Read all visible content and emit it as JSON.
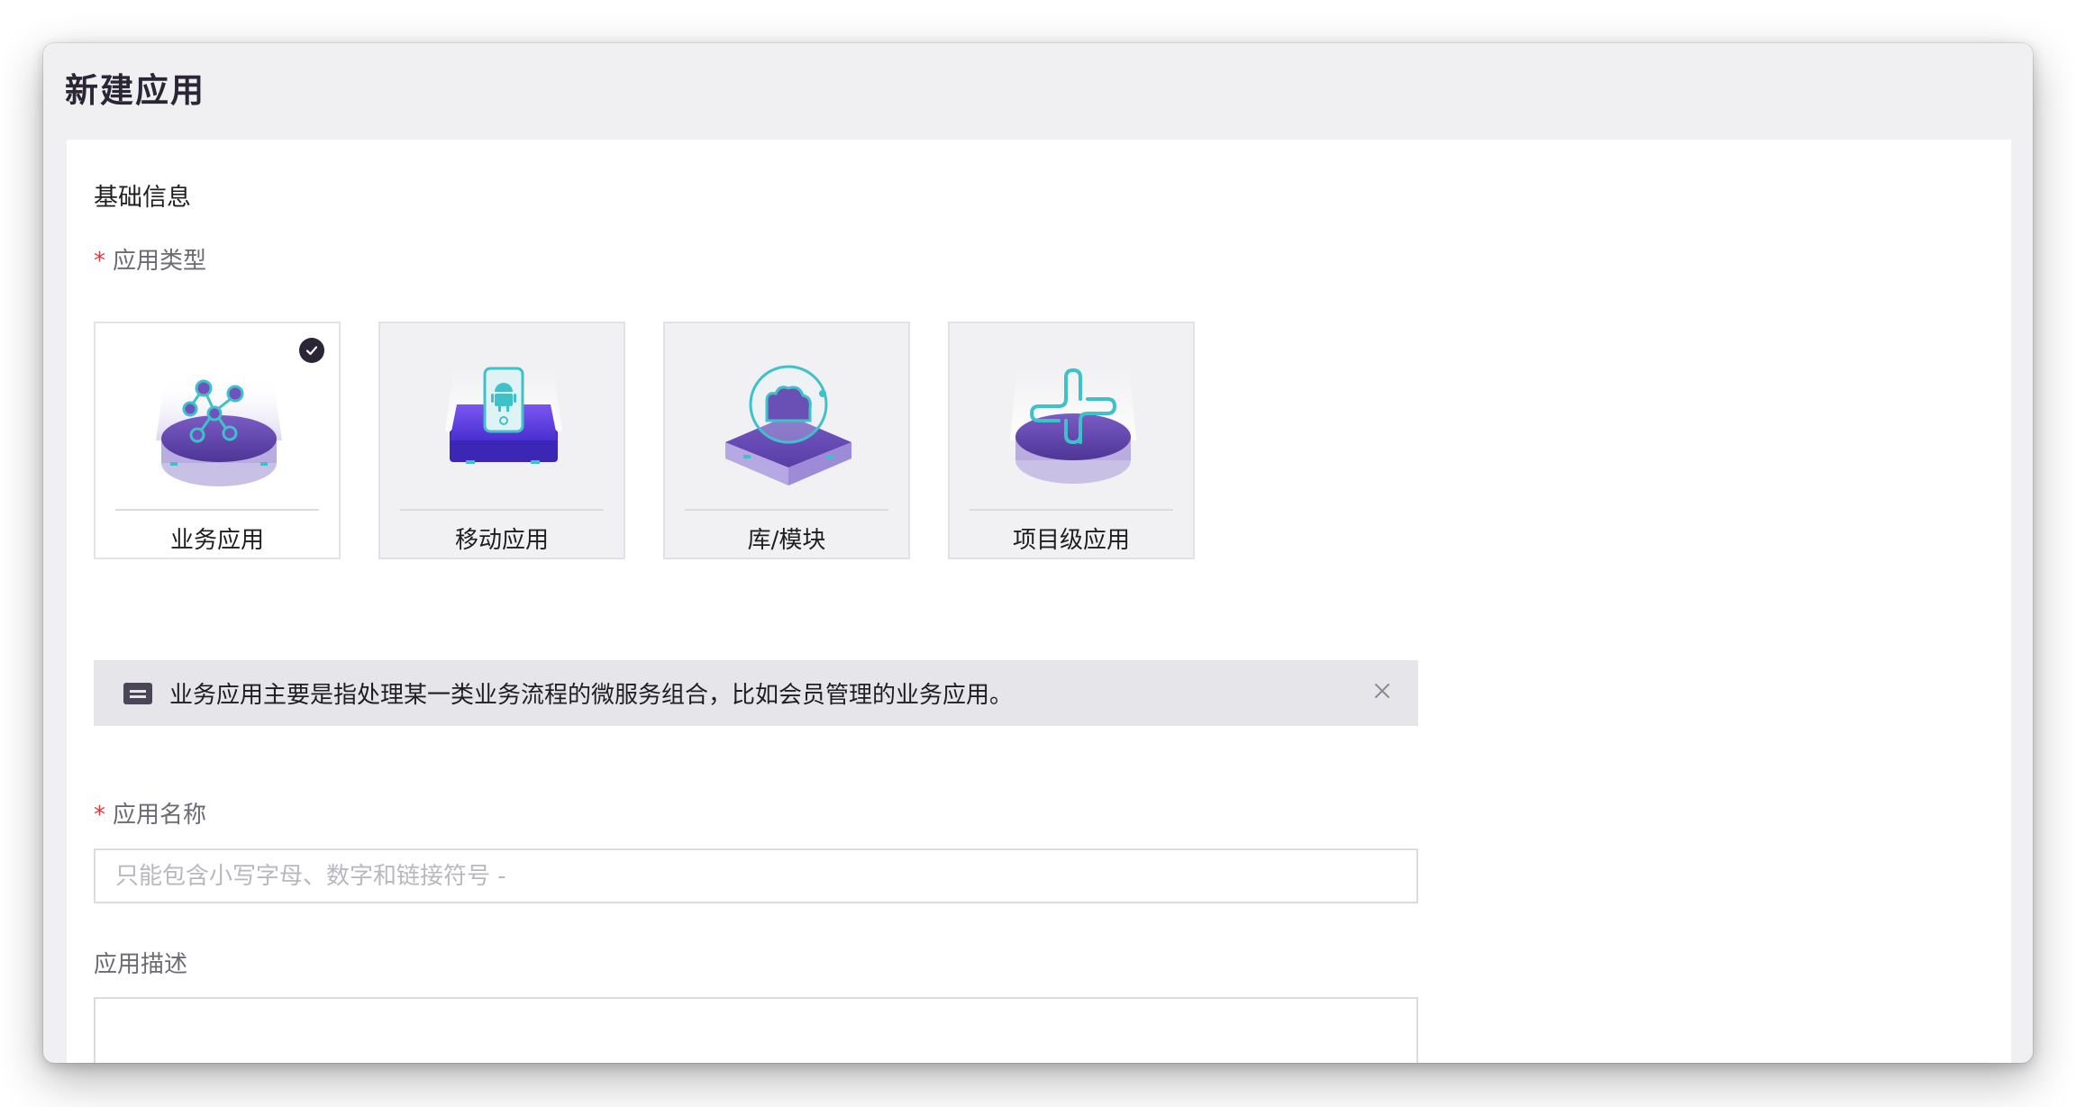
{
  "page": {
    "title": "新建应用"
  },
  "form": {
    "section_title": "基础信息",
    "type_field": {
      "required_mark": "*",
      "label": "应用类型"
    },
    "types": [
      {
        "label": "业务应用",
        "icon": "microservice-network-icon",
        "selected": true
      },
      {
        "label": "移动应用",
        "icon": "mobile-android-icon",
        "selected": false
      },
      {
        "label": "库/模块",
        "icon": "library-module-icon",
        "selected": false
      },
      {
        "label": "项目级应用",
        "icon": "project-cross-icon",
        "selected": false
      }
    ],
    "type_description": "业务应用主要是指处理某一类业务流程的微服务组合，比如会员管理的业务应用。",
    "name_field": {
      "required_mark": "*",
      "label": "应用名称",
      "placeholder": "只能包含小写字母、数字和链接符号 -",
      "value": ""
    },
    "description_field": {
      "label": "应用描述",
      "value": ""
    }
  },
  "colors": {
    "accent_purple": "#6a4fb4",
    "teal_icon": "#3fc1c9",
    "required": "#e0393e",
    "check_bg": "#2a2638"
  }
}
